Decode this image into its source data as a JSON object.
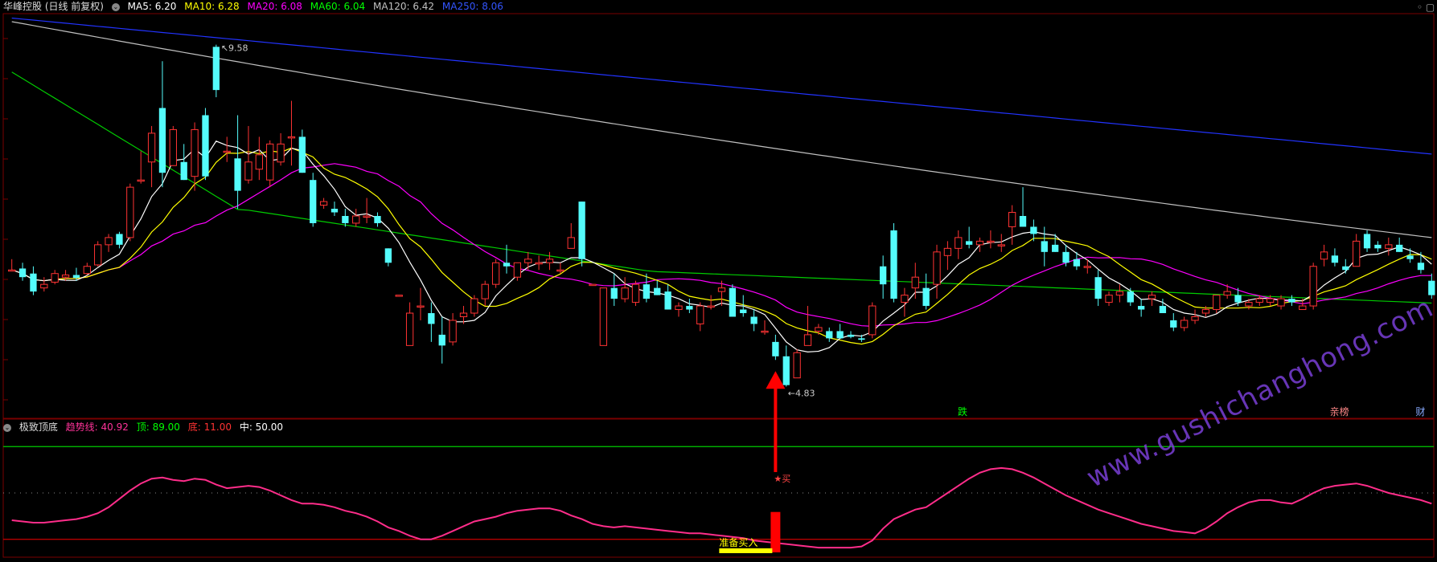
{
  "main_header": {
    "title": "华峰控股 (日线 前复权)",
    "ma_labels": [
      {
        "text": "MA5: 6.20",
        "color": "#ffffff"
      },
      {
        "text": "MA10: 6.28",
        "color": "#ffff00"
      },
      {
        "text": "MA20: 6.08",
        "color": "#ff00ff"
      },
      {
        "text": "MA60: 6.04",
        "color": "#00ff00"
      },
      {
        "text": "MA120: 6.42",
        "color": "#c0c0c0"
      },
      {
        "text": "MA250: 8.06",
        "color": "#3355ff"
      }
    ]
  },
  "indicator_header": {
    "title": "极致顶底",
    "labels": [
      {
        "text": "趋势线: 40.92",
        "color": "#ff3399"
      },
      {
        "text": "顶: 89.00",
        "color": "#00ff00"
      },
      {
        "text": "底: 11.00",
        "color": "#ff3333"
      },
      {
        "text": "中: 50.00",
        "color": "#ffffff"
      }
    ]
  },
  "annotations": {
    "high": "9.58",
    "low": "4.83",
    "buy_mark": "★买",
    "prepare_buy": "准备买入",
    "event_die": "跌",
    "event_qin": "亲榜",
    "event_cai": "财"
  },
  "watermark": "www.gushichanghong.com",
  "colors": {
    "up": "#ff3333",
    "down": "#54fcfc",
    "ma5": "#ffffff",
    "ma10": "#ffff00",
    "ma20": "#ff00ff",
    "ma60": "#00cc00",
    "ma120": "#c0c0c0",
    "ma250": "#2233ff",
    "trend": "#ff2d8a",
    "top_line": "#00cc00",
    "bottom_line": "#cc0000",
    "grid": "#7a0000"
  },
  "chart_data": [
    {
      "type": "candlestick",
      "title": "华峰控股 (日线 前复权)",
      "ylim": [
        4.4,
        10.0
      ],
      "grid": true,
      "candles": [
        [
          6.45,
          6.6,
          6.45,
          6.45
        ],
        [
          6.47,
          6.55,
          6.3,
          6.35
        ],
        [
          6.4,
          6.5,
          6.1,
          6.15
        ],
        [
          6.2,
          6.35,
          6.15,
          6.25
        ],
        [
          6.28,
          6.45,
          6.25,
          6.4
        ],
        [
          6.35,
          6.45,
          6.3,
          6.38
        ],
        [
          6.38,
          6.48,
          6.3,
          6.34
        ],
        [
          6.4,
          6.55,
          6.38,
          6.5
        ],
        [
          6.52,
          6.85,
          6.5,
          6.8
        ],
        [
          6.8,
          6.95,
          6.7,
          6.9
        ],
        [
          6.95,
          6.98,
          6.75,
          6.8
        ],
        [
          6.9,
          7.65,
          6.85,
          7.6
        ],
        [
          7.7,
          8.1,
          7.65,
          7.7
        ],
        [
          7.95,
          8.45,
          7.6,
          8.35
        ],
        [
          8.7,
          9.35,
          7.6,
          7.8
        ],
        [
          7.9,
          8.45,
          7.9,
          8.4
        ],
        [
          7.95,
          8.2,
          7.7,
          7.7
        ],
        [
          7.75,
          8.5,
          7.55,
          8.4
        ],
        [
          8.6,
          8.7,
          7.7,
          7.75
        ],
        [
          9.55,
          9.58,
          8.85,
          8.95
        ],
        [
          8.1,
          8.3,
          7.95,
          8.1
        ],
        [
          8.0,
          8.6,
          7.3,
          7.55
        ],
        [
          7.7,
          8.45,
          7.65,
          7.95
        ],
        [
          7.85,
          8.3,
          7.7,
          8.05
        ],
        [
          7.7,
          8.25,
          7.6,
          8.2
        ],
        [
          7.95,
          8.35,
          7.9,
          8.2
        ],
        [
          8.3,
          8.8,
          7.9,
          8.3
        ],
        [
          8.3,
          8.4,
          7.8,
          7.8
        ],
        [
          7.7,
          7.8,
          7.05,
          7.1
        ],
        [
          7.35,
          7.45,
          7.3,
          7.4
        ],
        [
          7.3,
          7.4,
          7.2,
          7.25
        ],
        [
          7.2,
          7.3,
          7.05,
          7.1
        ],
        [
          7.1,
          7.3,
          7.05,
          7.2
        ],
        [
          7.2,
          7.45,
          7.1,
          7.2
        ],
        [
          7.2,
          7.25,
          7.05,
          7.1
        ],
        [
          6.75,
          6.75,
          6.5,
          6.55
        ],
        [
          6.1,
          6.1,
          6.08,
          6.1
        ],
        [
          5.4,
          6.0,
          5.4,
          5.85
        ],
        [
          5.95,
          6.2,
          5.75,
          5.95
        ],
        [
          5.85,
          6.0,
          5.45,
          5.7
        ],
        [
          5.55,
          5.8,
          5.15,
          5.4
        ],
        [
          5.45,
          5.85,
          5.4,
          5.75
        ],
        [
          5.8,
          5.95,
          5.7,
          5.85
        ],
        [
          5.85,
          6.1,
          5.8,
          6.05
        ],
        [
          6.05,
          6.3,
          5.95,
          6.25
        ],
        [
          6.25,
          6.6,
          6.2,
          6.55
        ],
        [
          6.55,
          6.8,
          6.4,
          6.5
        ],
        [
          6.35,
          6.55,
          6.3,
          6.55
        ],
        [
          6.55,
          6.7,
          6.45,
          6.6
        ],
        [
          6.55,
          6.65,
          6.45,
          6.55
        ],
        [
          6.55,
          6.7,
          6.45,
          6.6
        ],
        [
          6.45,
          6.55,
          6.4,
          6.45
        ],
        [
          6.75,
          7.1,
          6.75,
          6.9
        ],
        [
          7.4,
          7.4,
          6.5,
          6.6
        ],
        [
          6.25,
          6.25,
          6.23,
          6.25
        ],
        [
          5.4,
          6.2,
          5.4,
          6.2
        ],
        [
          6.2,
          6.4,
          5.95,
          6.05
        ],
        [
          6.05,
          6.35,
          6.0,
          6.2
        ],
        [
          6.0,
          6.3,
          5.95,
          6.25
        ],
        [
          6.25,
          6.4,
          6.0,
          6.05
        ],
        [
          6.2,
          6.3,
          6.1,
          6.1
        ],
        [
          6.15,
          6.25,
          5.9,
          5.9
        ],
        [
          5.9,
          6.0,
          5.8,
          5.95
        ],
        [
          5.95,
          6.05,
          5.85,
          5.9
        ],
        [
          5.7,
          6.0,
          5.6,
          5.95
        ],
        [
          5.95,
          6.1,
          5.9,
          5.95
        ],
        [
          6.15,
          6.3,
          5.95,
          6.2
        ],
        [
          6.2,
          6.25,
          5.8,
          5.8
        ],
        [
          5.9,
          6.1,
          5.8,
          5.85
        ],
        [
          5.8,
          5.9,
          5.6,
          5.7
        ],
        [
          5.6,
          5.75,
          5.55,
          5.6
        ],
        [
          5.45,
          5.55,
          5.2,
          5.25
        ],
        [
          5.25,
          5.4,
          4.83,
          4.85
        ],
        [
          4.95,
          5.35,
          4.95,
          5.3
        ],
        [
          5.4,
          5.95,
          5.4,
          5.55
        ],
        [
          5.6,
          5.7,
          5.55,
          5.65
        ],
        [
          5.6,
          5.65,
          5.45,
          5.5
        ],
        [
          5.6,
          5.7,
          5.5,
          5.5
        ],
        [
          5.55,
          5.6,
          5.5,
          5.52
        ],
        [
          5.5,
          5.55,
          5.45,
          5.48
        ],
        [
          5.55,
          6.0,
          5.5,
          5.95
        ],
        [
          6.5,
          6.65,
          6.05,
          6.25
        ],
        [
          7.0,
          7.1,
          6.0,
          6.05
        ],
        [
          6.0,
          6.2,
          5.8,
          6.1
        ],
        [
          6.2,
          6.55,
          6.05,
          6.35
        ],
        [
          6.2,
          6.4,
          5.9,
          5.95
        ],
        [
          6.25,
          6.8,
          6.05,
          6.7
        ],
        [
          6.65,
          6.85,
          6.45,
          6.75
        ],
        [
          6.75,
          7.0,
          6.6,
          6.9
        ],
        [
          6.85,
          7.05,
          6.75,
          6.8
        ],
        [
          6.8,
          6.9,
          6.7,
          6.85
        ],
        [
          6.85,
          7.0,
          6.75,
          6.85
        ],
        [
          6.8,
          6.95,
          6.7,
          6.8
        ],
        [
          7.05,
          7.35,
          6.8,
          7.25
        ],
        [
          7.2,
          7.6,
          7.05,
          7.05
        ],
        [
          7.05,
          7.15,
          6.85,
          6.95
        ],
        [
          6.85,
          7.05,
          6.5,
          6.7
        ],
        [
          6.8,
          6.95,
          6.7,
          6.7
        ],
        [
          6.7,
          6.8,
          6.5,
          6.55
        ],
        [
          6.6,
          6.7,
          6.45,
          6.5
        ],
        [
          6.5,
          6.6,
          6.4,
          6.5
        ],
        [
          6.35,
          6.45,
          5.95,
          6.05
        ],
        [
          6.0,
          6.15,
          5.95,
          6.1
        ],
        [
          6.1,
          6.25,
          6.0,
          6.15
        ],
        [
          6.15,
          6.2,
          5.95,
          6.0
        ],
        [
          5.95,
          6.05,
          5.8,
          5.9
        ],
        [
          6.05,
          6.15,
          5.95,
          6.1
        ],
        [
          5.95,
          6.05,
          5.85,
          5.85
        ],
        [
          5.75,
          5.85,
          5.6,
          5.65
        ],
        [
          5.65,
          5.8,
          5.6,
          5.75
        ],
        [
          5.75,
          5.9,
          5.7,
          5.8
        ],
        [
          5.85,
          5.95,
          5.8,
          5.9
        ],
        [
          5.9,
          6.1,
          5.85,
          6.1
        ],
        [
          6.1,
          6.25,
          6.05,
          6.15
        ],
        [
          6.1,
          6.2,
          5.95,
          6.0
        ],
        [
          5.95,
          6.05,
          5.9,
          6.0
        ],
        [
          6.0,
          6.1,
          5.95,
          6.05
        ],
        [
          6.0,
          6.1,
          5.95,
          6.05
        ],
        [
          5.95,
          6.1,
          5.9,
          6.05
        ],
        [
          6.05,
          6.1,
          5.95,
          6.0
        ],
        [
          5.9,
          6.05,
          5.9,
          5.95
        ],
        [
          5.95,
          6.55,
          5.9,
          6.5
        ],
        [
          6.6,
          6.8,
          6.5,
          6.7
        ],
        [
          6.65,
          6.75,
          6.5,
          6.55
        ],
        [
          6.5,
          6.6,
          6.4,
          6.45
        ],
        [
          6.5,
          6.95,
          6.5,
          6.85
        ],
        [
          6.95,
          7.0,
          6.7,
          6.75
        ],
        [
          6.8,
          6.85,
          6.7,
          6.75
        ],
        [
          6.75,
          6.9,
          6.65,
          6.8
        ],
        [
          6.8,
          6.9,
          6.7,
          6.7
        ],
        [
          6.65,
          6.75,
          6.55,
          6.6
        ],
        [
          6.55,
          6.7,
          6.4,
          6.45
        ],
        [
          6.3,
          6.4,
          6.05,
          6.1
        ]
      ],
      "x_labels": [
        {
          "x": 101,
          "text": "9.58"
        },
        {
          "x": 72,
          "text": "4.83"
        }
      ]
    },
    {
      "type": "line",
      "title": "极致顶底",
      "ylim": [
        0,
        100
      ],
      "series": [
        {
          "name": "趋势线",
          "values": [
            27,
            26,
            25,
            25,
            26,
            27,
            28,
            30,
            33,
            38,
            45,
            52,
            58,
            62,
            63,
            61,
            60,
            62,
            61,
            57,
            54,
            55,
            56,
            55,
            52,
            48,
            44,
            41,
            41,
            40,
            38,
            35,
            33,
            30,
            26,
            21,
            18,
            14,
            11,
            11,
            14,
            18,
            22,
            26,
            28,
            30,
            33,
            35,
            36,
            37,
            37,
            35,
            31,
            28,
            24,
            22,
            21,
            22,
            21,
            20,
            19,
            18,
            17,
            16,
            16,
            15,
            14,
            13,
            12,
            10,
            9,
            8,
            7,
            6,
            5,
            4,
            4,
            4,
            4,
            5,
            10,
            20,
            28,
            32,
            36,
            38,
            44,
            50,
            56,
            62,
            67,
            70,
            71,
            70,
            67,
            63,
            58,
            53,
            48,
            44,
            40,
            36,
            33,
            30,
            27,
            24,
            22,
            20,
            18,
            17,
            16,
            20,
            26,
            33,
            38,
            42,
            44,
            44,
            42,
            41,
            45,
            50,
            54,
            56,
            57,
            58,
            56,
            53,
            50,
            48,
            46,
            44,
            41
          ],
          "color": "#ff2d8a"
        },
        {
          "name": "顶",
          "values": [
            89
          ]
        },
        {
          "name": "底",
          "values": [
            11
          ]
        },
        {
          "name": "中",
          "values": [
            50
          ]
        }
      ],
      "signal_bar": {
        "index": 71,
        "value": 34
      }
    }
  ]
}
